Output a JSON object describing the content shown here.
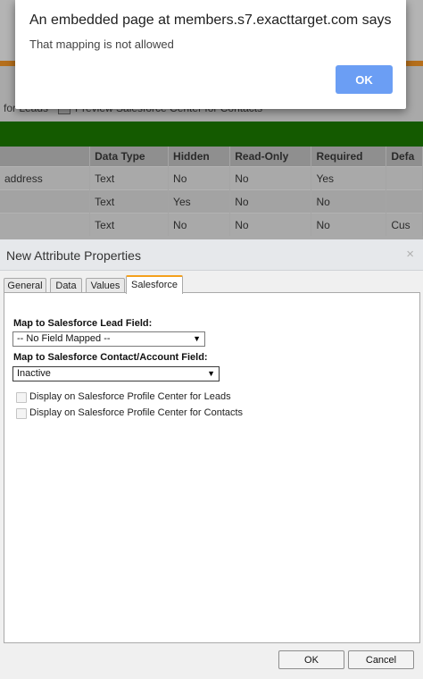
{
  "background": {
    "toolbar": {
      "leads_text": "for Leads",
      "contacts_text": "Preview Salesforce Center for Contacts"
    },
    "table": {
      "headers": [
        "",
        "Data Type",
        "Hidden",
        "Read-Only",
        "Required",
        "Defa"
      ],
      "rows": [
        [
          "address",
          "Text",
          "No",
          "No",
          "Yes",
          ""
        ],
        [
          "",
          "Text",
          "Yes",
          "No",
          "No",
          ""
        ],
        [
          "",
          "Text",
          "No",
          "No",
          "No",
          "Cus"
        ]
      ]
    }
  },
  "alert": {
    "title": "An embedded page at members.s7.exacttarget.com says",
    "message": "That mapping is not allowed",
    "ok_label": "OK",
    "ok_color": "#6b9ef4"
  },
  "dialog": {
    "title": "New Attribute Properties",
    "close_glyph": "×",
    "tabs": [
      {
        "label": "General",
        "active": false
      },
      {
        "label": "Data",
        "active": false
      },
      {
        "label": "Values",
        "active": false
      },
      {
        "label": "Salesforce",
        "active": true
      }
    ],
    "lead_field": {
      "label": "Map to Salesforce Lead Field:",
      "value": "-- No Field Mapped --"
    },
    "contact_field": {
      "label": "Map to Salesforce Contact/Account Field:",
      "value": "Inactive"
    },
    "checkboxes": [
      {
        "label": "Display on Salesforce Profile Center for Leads",
        "checked": false
      },
      {
        "label": "Display on Salesforce Profile Center for Contacts",
        "checked": false
      }
    ],
    "ok_label": "OK",
    "cancel_label": "Cancel",
    "active_tab_accent": "#f4a01c"
  },
  "icons": {
    "dropdown_arrow": "▼",
    "close": "close-icon"
  }
}
